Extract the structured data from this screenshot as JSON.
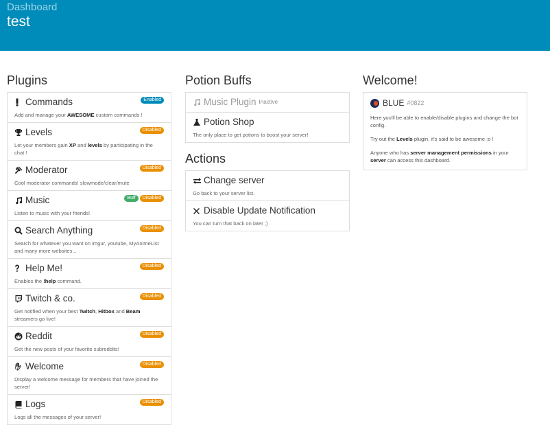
{
  "header": {
    "crumb": "Dashboard",
    "title": "test"
  },
  "plugins": {
    "heading": "Plugins",
    "items": [
      {
        "icon": "exclamation-icon",
        "name": "Commands",
        "badges": [
          {
            "label": "Enabled",
            "kind": "enabled"
          }
        ],
        "desc_pre": "Add and manage your ",
        "desc_b1": "AWESOME",
        "desc_mid": " custom commands !",
        "desc_b2": "",
        "desc_post": ""
      },
      {
        "icon": "trophy-icon",
        "name": "Levels",
        "badges": [
          {
            "label": "Disabled",
            "kind": "disabled"
          }
        ],
        "desc_pre": "Let your members gain ",
        "desc_b1": "XP",
        "desc_mid": " and ",
        "desc_b2": "levels",
        "desc_post": " by participating in the chat !"
      },
      {
        "icon": "gavel-icon",
        "name": "Moderator",
        "badges": [
          {
            "label": "Disabled",
            "kind": "disabled"
          }
        ],
        "desc_pre": "Cool moderator commands! slowmode/clear/mute",
        "desc_b1": "",
        "desc_mid": "",
        "desc_b2": "",
        "desc_post": ""
      },
      {
        "icon": "music-icon",
        "name": "Music",
        "badges": [
          {
            "label": "Buff",
            "kind": "buff"
          },
          {
            "label": "Disabled",
            "kind": "disabled"
          }
        ],
        "desc_pre": "Listen to music with your friends!",
        "desc_b1": "",
        "desc_mid": "",
        "desc_b2": "",
        "desc_post": ""
      },
      {
        "icon": "search-icon",
        "name": "Search Anything",
        "badges": [
          {
            "label": "Disabled",
            "kind": "disabled"
          }
        ],
        "desc_pre": "Search for whatever you want on imgur, youtube, MyAnimeList and many more websites...",
        "desc_b1": "",
        "desc_mid": "",
        "desc_b2": "",
        "desc_post": ""
      },
      {
        "icon": "question-icon",
        "name": "Help Me!",
        "badges": [
          {
            "label": "Disabled",
            "kind": "disabled"
          }
        ],
        "desc_pre": "Enables the ",
        "desc_b1": "!help",
        "desc_mid": " command.",
        "desc_b2": "",
        "desc_post": ""
      },
      {
        "icon": "twitch-icon",
        "name": "Twitch & co.",
        "badges": [
          {
            "label": "Disabled",
            "kind": "disabled"
          }
        ],
        "desc_pre": "Get notified when your best ",
        "desc_b1": "Twitch",
        "desc_mid": ", ",
        "desc_b2": "Hitbox",
        "desc_post": " and ",
        "desc_b3": "Beam",
        "desc_end": " streamers go live!"
      },
      {
        "icon": "reddit-icon",
        "name": "Reddit",
        "badges": [
          {
            "label": "Disabled",
            "kind": "disabled"
          }
        ],
        "desc_pre": "Get the new posts of your favorite subreddits!",
        "desc_b1": "",
        "desc_mid": "",
        "desc_b2": "",
        "desc_post": ""
      },
      {
        "icon": "hand-icon",
        "name": "Welcome",
        "badges": [
          {
            "label": "Disabled",
            "kind": "disabled"
          }
        ],
        "desc_pre": "Display a welcome message for members that have joined the server!",
        "desc_b1": "",
        "desc_mid": "",
        "desc_b2": "",
        "desc_post": ""
      },
      {
        "icon": "book-icon",
        "name": "Logs",
        "badges": [
          {
            "label": "Disabled",
            "kind": "disabled"
          }
        ],
        "desc_pre": "Logs all the messages of your server!",
        "desc_b1": "",
        "desc_mid": "",
        "desc_b2": "",
        "desc_post": ""
      }
    ]
  },
  "potion": {
    "heading": "Potion Buffs",
    "music_plugin": {
      "name": "Music Plugin",
      "status": "Inactive"
    },
    "shop": {
      "name": "Potion Shop",
      "desc": "The only place to get potions to boost your server!"
    }
  },
  "actions": {
    "heading": "Actions",
    "change": {
      "name": "Change server",
      "desc": "Go back to your server list."
    },
    "disable": {
      "name": "Disable Update Notification",
      "desc": "You can turn that back on later ;)"
    }
  },
  "welcome": {
    "heading": "Welcome!",
    "user": "BLUE",
    "disc": "#0822",
    "p1": "Here you'll be able to enable/disable plugins and change the bot config.",
    "p2_pre": "Try out the ",
    "p2_b": "Levels",
    "p2_post": " plugin, it's said to be awesome :o !",
    "p3_pre": "Anyone who has ",
    "p3_b1": "server management permissions",
    "p3_mid": " in your ",
    "p3_b2": "server",
    "p3_post": " can access this dashboard."
  },
  "colors": {
    "header": "#008cba",
    "enabled": "#008cba",
    "disabled": "#e99002",
    "buff": "#43ac6a"
  }
}
